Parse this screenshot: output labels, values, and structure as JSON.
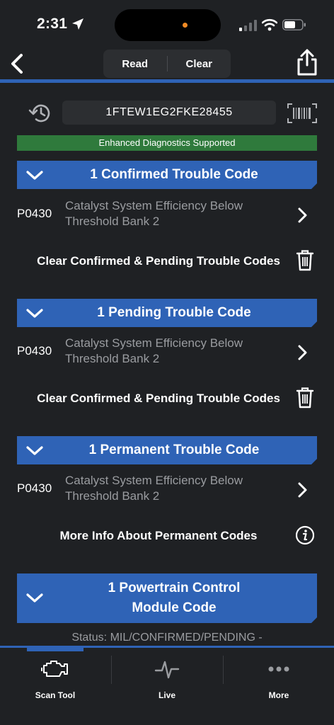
{
  "status_bar": {
    "time": "2:31"
  },
  "header": {
    "read_label": "Read",
    "clear_label": "Clear"
  },
  "vin": "1FTEW1EG2FKE28455",
  "banner": "Enhanced Diagnostics Supported",
  "sections": {
    "confirmed": {
      "title": "1 Confirmed Trouble Code",
      "code": "P0430",
      "desc": "Catalyst System Efficiency Below Threshold Bank 2",
      "action": "Clear Confirmed & Pending Trouble Codes"
    },
    "pending": {
      "title": "1 Pending Trouble Code",
      "code": "P0430",
      "desc": "Catalyst System Efficiency Below Threshold Bank 2",
      "action": "Clear Confirmed & Pending Trouble Codes"
    },
    "permanent": {
      "title": "1 Permanent Trouble Code",
      "code": "P0430",
      "desc": "Catalyst System Efficiency Below Threshold Bank 2",
      "action": "More Info About Permanent Codes"
    },
    "pcm": {
      "title": "1 Powertrain Control\nModule Code",
      "status": "Status: MIL/CONFIRMED/PENDING -"
    }
  },
  "tabs": [
    {
      "label": "Scan Tool",
      "icon": "engine-icon",
      "active": true
    },
    {
      "label": "Live",
      "icon": "pulse-icon",
      "active": false
    },
    {
      "label": "More",
      "icon": "more-dots-icon",
      "active": false
    }
  ],
  "colors": {
    "accent": "#2f63b6",
    "banner_green": "#2f7a3c",
    "background": "#1f2124"
  }
}
